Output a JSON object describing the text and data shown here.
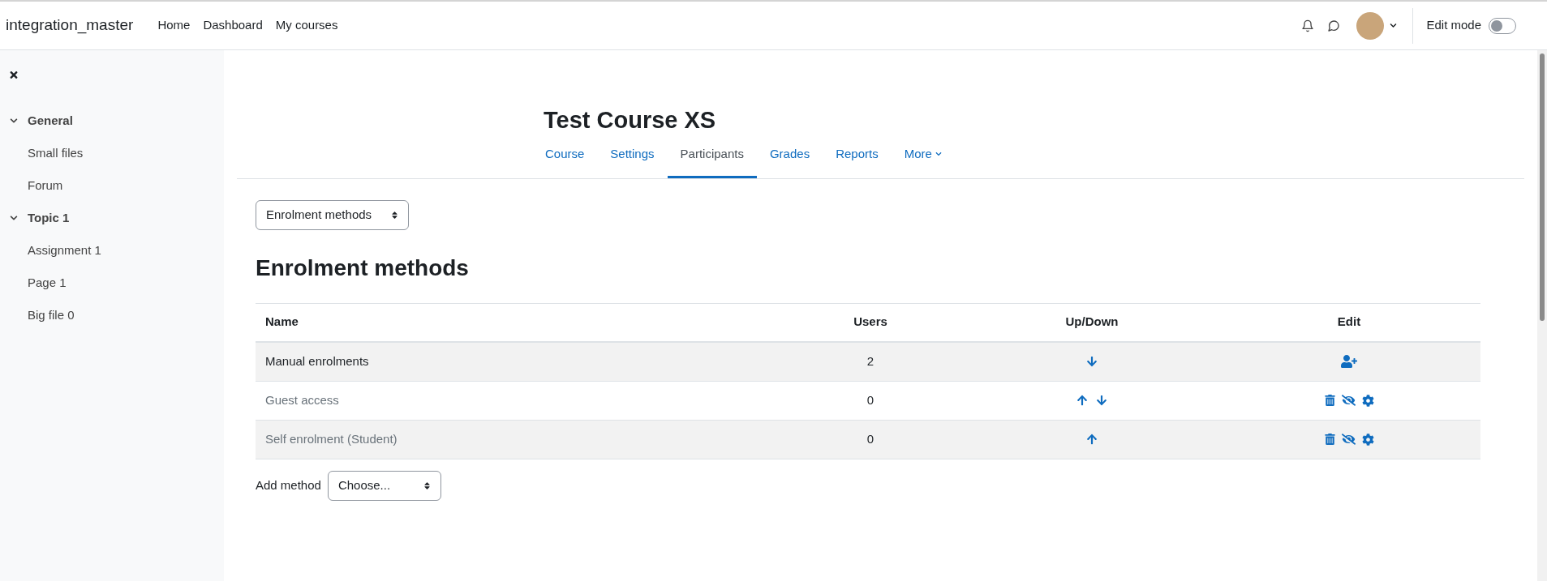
{
  "navbar": {
    "site_name": "integration_master",
    "links": [
      "Home",
      "Dashboard",
      "My courses"
    ],
    "edit_mode": {
      "label": "Edit mode",
      "on": false
    }
  },
  "sidebar": {
    "sections": [
      {
        "title": "General",
        "expanded": true,
        "children": [
          "Small files",
          "Forum"
        ]
      },
      {
        "title": "Topic 1",
        "expanded": true,
        "children": [
          "Assignment 1",
          "Page 1",
          "Big file 0"
        ]
      }
    ]
  },
  "course_title": "Test Course XS",
  "tabs": [
    {
      "label": "Course",
      "selected": false
    },
    {
      "label": "Settings",
      "selected": false
    },
    {
      "label": "Participants",
      "selected": true
    },
    {
      "label": "Grades",
      "selected": false
    },
    {
      "label": "Reports",
      "selected": false
    },
    {
      "label": "More",
      "selected": false,
      "dropdown": true
    }
  ],
  "page_select": "Enrolment methods",
  "heading": "Enrolment methods",
  "table": {
    "columns": [
      "Name",
      "Users",
      "Up/Down",
      "Edit"
    ],
    "rows": [
      {
        "name": "Manual enrolments",
        "users": "2",
        "disabled": false,
        "move": [
          {
            "kind": "down"
          }
        ],
        "edit": [
          {
            "kind": "enrol"
          }
        ]
      },
      {
        "name": "Guest access",
        "users": "0",
        "disabled": true,
        "move": [
          {
            "kind": "up"
          },
          {
            "kind": "down"
          }
        ],
        "edit": [
          {
            "kind": "delete"
          },
          {
            "kind": "hide"
          },
          {
            "kind": "settings"
          }
        ]
      },
      {
        "name": "Self enrolment (Student)",
        "users": "0",
        "disabled": true,
        "move": [
          {
            "kind": "up"
          }
        ],
        "edit": [
          {
            "kind": "delete"
          },
          {
            "kind": "hide"
          },
          {
            "kind": "settings"
          }
        ]
      }
    ]
  },
  "add_method": {
    "label": "Add method",
    "value": "Choose..."
  }
}
